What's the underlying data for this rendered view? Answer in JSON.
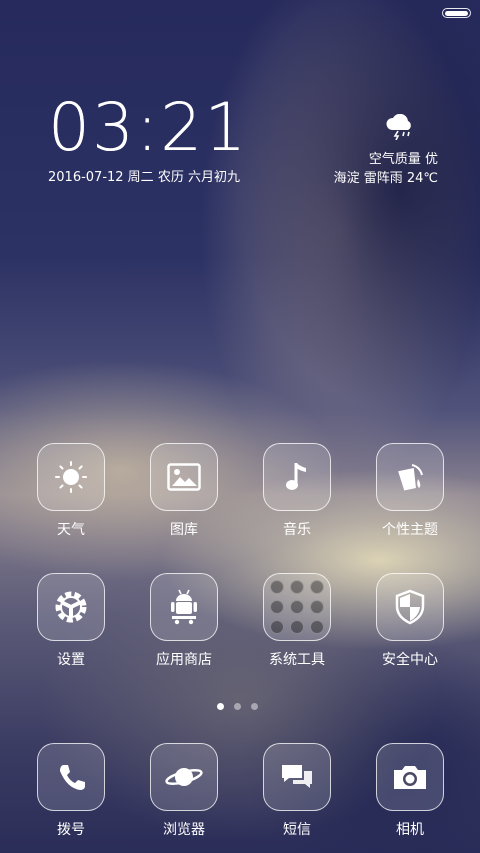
{
  "status_bar": {
    "battery_icon": "battery-icon"
  },
  "clock": {
    "time": "03:21"
  },
  "date_line": "2016-07-12 周二 农历 六月初九",
  "weather": {
    "icon": "thunderstorm-icon",
    "air_quality": "空气质量 优",
    "location_condition": "海淀 雷阵雨 24℃"
  },
  "apps_row1": [
    {
      "label": "天气",
      "icon": "sun-icon"
    },
    {
      "label": "图库",
      "icon": "gallery-icon"
    },
    {
      "label": "音乐",
      "icon": "music-note-icon"
    },
    {
      "label": "个性主题",
      "icon": "paint-bucket-icon"
    }
  ],
  "apps_row2": [
    {
      "label": "设置",
      "icon": "gear-icon"
    },
    {
      "label": "应用商店",
      "icon": "android-cart-icon"
    },
    {
      "label": "系统工具",
      "icon": "folder-grid-icon"
    },
    {
      "label": "安全中心",
      "icon": "shield-icon"
    }
  ],
  "page_indicator": {
    "pages": 3,
    "current": 1
  },
  "dock": [
    {
      "label": "拨号",
      "icon": "phone-icon"
    },
    {
      "label": "浏览器",
      "icon": "planet-icon"
    },
    {
      "label": "短信",
      "icon": "chat-bubble-icon"
    },
    {
      "label": "相机",
      "icon": "camera-icon"
    }
  ]
}
